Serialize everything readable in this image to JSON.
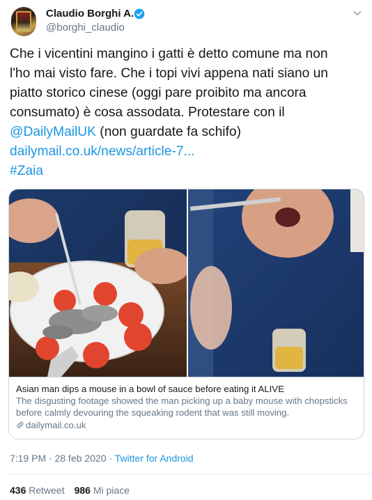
{
  "author": {
    "name": "Claudio Borghi A.",
    "handle": "@borghi_claudio",
    "verified": true
  },
  "tweet": {
    "lines": [
      "Che i vicentini mangino i gatti è detto comune ma non",
      "l'ho mai visto fare. Che i topi vivi appena nati siano un",
      "piatto storico cinese (oggi pare proibito ma ancora",
      "consumato) è cosa assodata. Protestare con il"
    ],
    "mention": "@DailyMailUK",
    "after_mention": " (non guardate fa schifo)",
    "url": "dailymail.co.uk/news/article-7...",
    "hashtag": "#Zaia"
  },
  "card": {
    "title": "Asian man dips a mouse in a bowl of sauce before eating it ALIVE",
    "desc_line1": "The disgusting footage showed the man picking up a baby mouse with chopsticks",
    "desc_line2": "before calmly devouring the squeaking rodent that was still moving.",
    "domain": "dailymail.co.uk"
  },
  "meta": {
    "time": "7:19 PM",
    "date": "28 feb 2020",
    "separator": "·",
    "app": "Twitter for Android"
  },
  "stats": {
    "retweets_count": "436",
    "retweets_label": "Retweet",
    "likes_count": "986",
    "likes_label": "Mi piace"
  },
  "colors": {
    "link": "#1b95e0",
    "verified_badge": "#1da1f2",
    "secondary_text": "#657786"
  },
  "icons": [
    "verified-badge-icon",
    "chevron-down-icon",
    "link-icon"
  ]
}
